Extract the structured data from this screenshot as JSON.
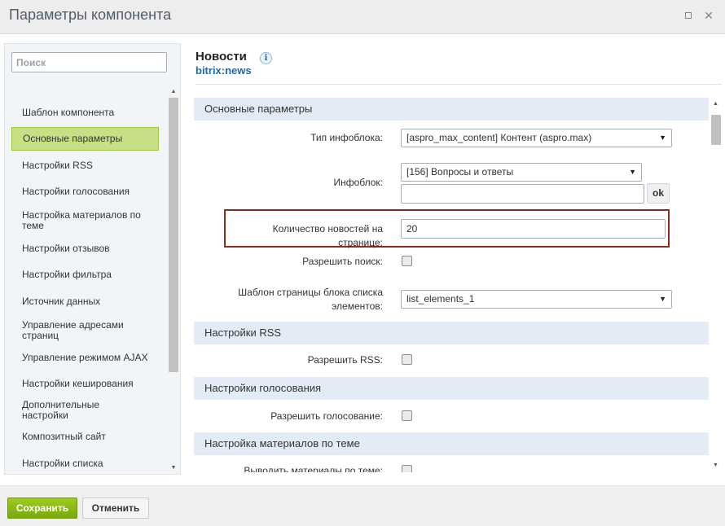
{
  "window": {
    "title": "Параметры компонента",
    "maximize_icon": "maximize-icon",
    "close_icon": "close-icon",
    "close_glyph": "✕"
  },
  "sidebar": {
    "search_placeholder": "Поиск",
    "items": [
      {
        "label": "Шаблон компонента",
        "active": false
      },
      {
        "label": "Основные параметры",
        "active": true
      },
      {
        "label": "Настройки RSS",
        "active": false
      },
      {
        "label": "Настройки голосования",
        "active": false
      },
      {
        "label": "Настройка материалов по теме",
        "active": false
      },
      {
        "label": "Настройки отзывов",
        "active": false
      },
      {
        "label": "Настройки фильтра",
        "active": false
      },
      {
        "label": "Источник данных",
        "active": false
      },
      {
        "label": "Управление адресами страниц",
        "active": false
      },
      {
        "label": "Управление режимом AJAX",
        "active": false
      },
      {
        "label": "Настройки кеширования",
        "active": false
      },
      {
        "label": "Дополнительные настройки",
        "active": false
      },
      {
        "label": "Композитный сайт",
        "active": false
      },
      {
        "label": "Настройки списка",
        "active": false
      }
    ]
  },
  "component": {
    "name": "Новости",
    "code": "bitrix:news",
    "info_glyph": "i"
  },
  "sections": {
    "main": "Основные параметры",
    "rss": "Настройки RSS",
    "voting": "Настройки голосования",
    "related": "Настройка материалов по теме"
  },
  "fields": {
    "iblock_type": {
      "label": "Тип инфоблока:",
      "value": "[aspro_max_content] Контент (aspro.max)"
    },
    "iblock": {
      "label": "Инфоблок:",
      "value": "[156] Вопросы и ответы",
      "text_value": "",
      "ok_label": "ok"
    },
    "news_count": {
      "label": "Количество новостей на странице:",
      "value": "20"
    },
    "allow_search": {
      "label": "Разрешить поиск:",
      "checked": false
    },
    "list_template": {
      "label": "Шаблон страницы блока списка элементов:",
      "value": "list_elements_1"
    },
    "allow_rss": {
      "label": "Разрешить RSS:",
      "checked": false
    },
    "allow_voting": {
      "label": "Разрешить голосование:",
      "checked": false
    },
    "show_related": {
      "label": "Выводить материалы по теме:",
      "checked": false
    }
  },
  "footer": {
    "save_label": "Сохранить",
    "cancel_label": "Отменить"
  },
  "colors": {
    "save_button": "#8bbb11",
    "active_item": "#c8e085",
    "highlight_border": "#8b2a1e",
    "section_bg": "#e3ecf6",
    "link_blue": "#2067b0"
  }
}
